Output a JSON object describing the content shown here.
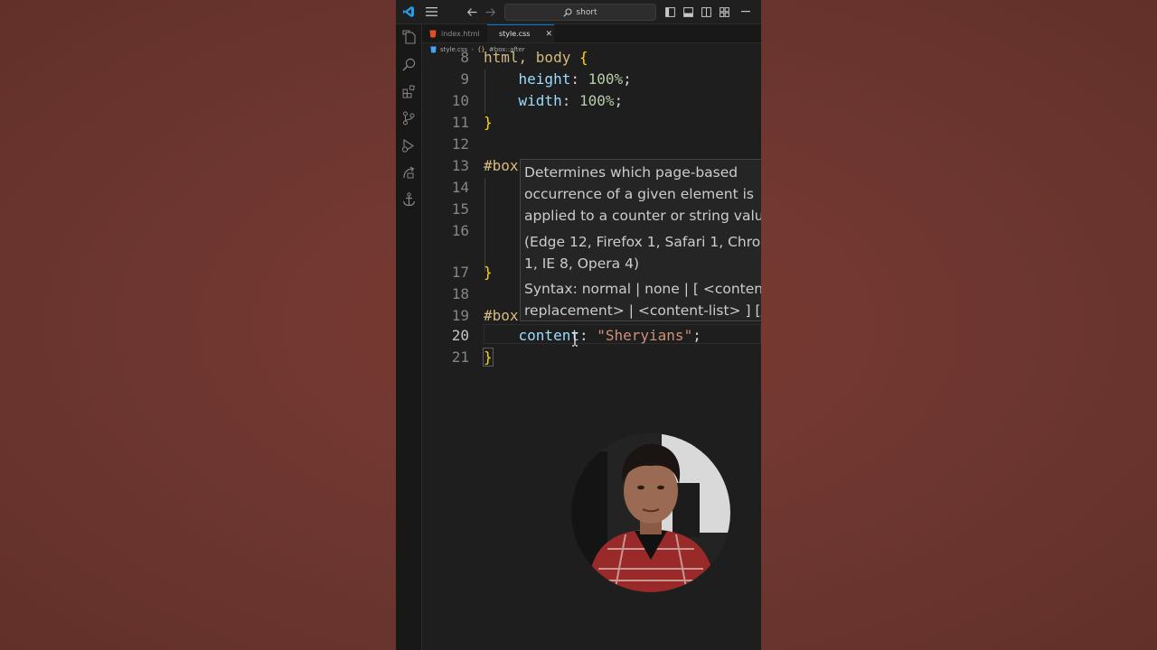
{
  "titlebar": {
    "search_text": "short"
  },
  "tabs": [
    {
      "label": "index.html",
      "icon": "html-file-icon",
      "active": false
    },
    {
      "label": "style.css",
      "icon": "css-file-icon",
      "active": true
    }
  ],
  "breadcrumb": {
    "file": "style.css",
    "symbol": "#box::after"
  },
  "code_lines": [
    {
      "number": "8",
      "text": "html, body {"
    },
    {
      "number": "9",
      "text": "    height: 100%;"
    },
    {
      "number": "10",
      "text": "    width: 100%;"
    },
    {
      "number": "11",
      "text": "}"
    },
    {
      "number": "12",
      "text": ""
    },
    {
      "number": "13",
      "text": "#box"
    },
    {
      "number": "14",
      "text": ""
    },
    {
      "number": "15",
      "text": ""
    },
    {
      "number": "16",
      "text": ""
    },
    {
      "number": "17",
      "text": "}"
    },
    {
      "number": "18",
      "text": ""
    },
    {
      "number": "19",
      "text": "#box"
    },
    {
      "number": "20",
      "text": "    content: \"Sheryians\";"
    },
    {
      "number": "21",
      "text": "}"
    }
  ],
  "tooltip": {
    "description_1": "Determines which page-based",
    "description_2": "occurrence of a given element is",
    "description_3": "applied to a counter or string valu",
    "compat_1": "(Edge 12, Firefox 1, Safari 1, Chron",
    "compat_2": "1, IE 8, Opera 4)",
    "syntax_1": "Syntax: normal | none | [ <content",
    "syntax_2": "replacement> | <content-list> ] [/"
  },
  "colors": {
    "background": "#6d3630",
    "editor_bg": "#1e1e1e",
    "accent": "#0078d4",
    "selector": "#d7ba7d",
    "property": "#9cdcfe",
    "number": "#b5cea8",
    "string": "#ce9178",
    "bracket": "#ffd700"
  }
}
